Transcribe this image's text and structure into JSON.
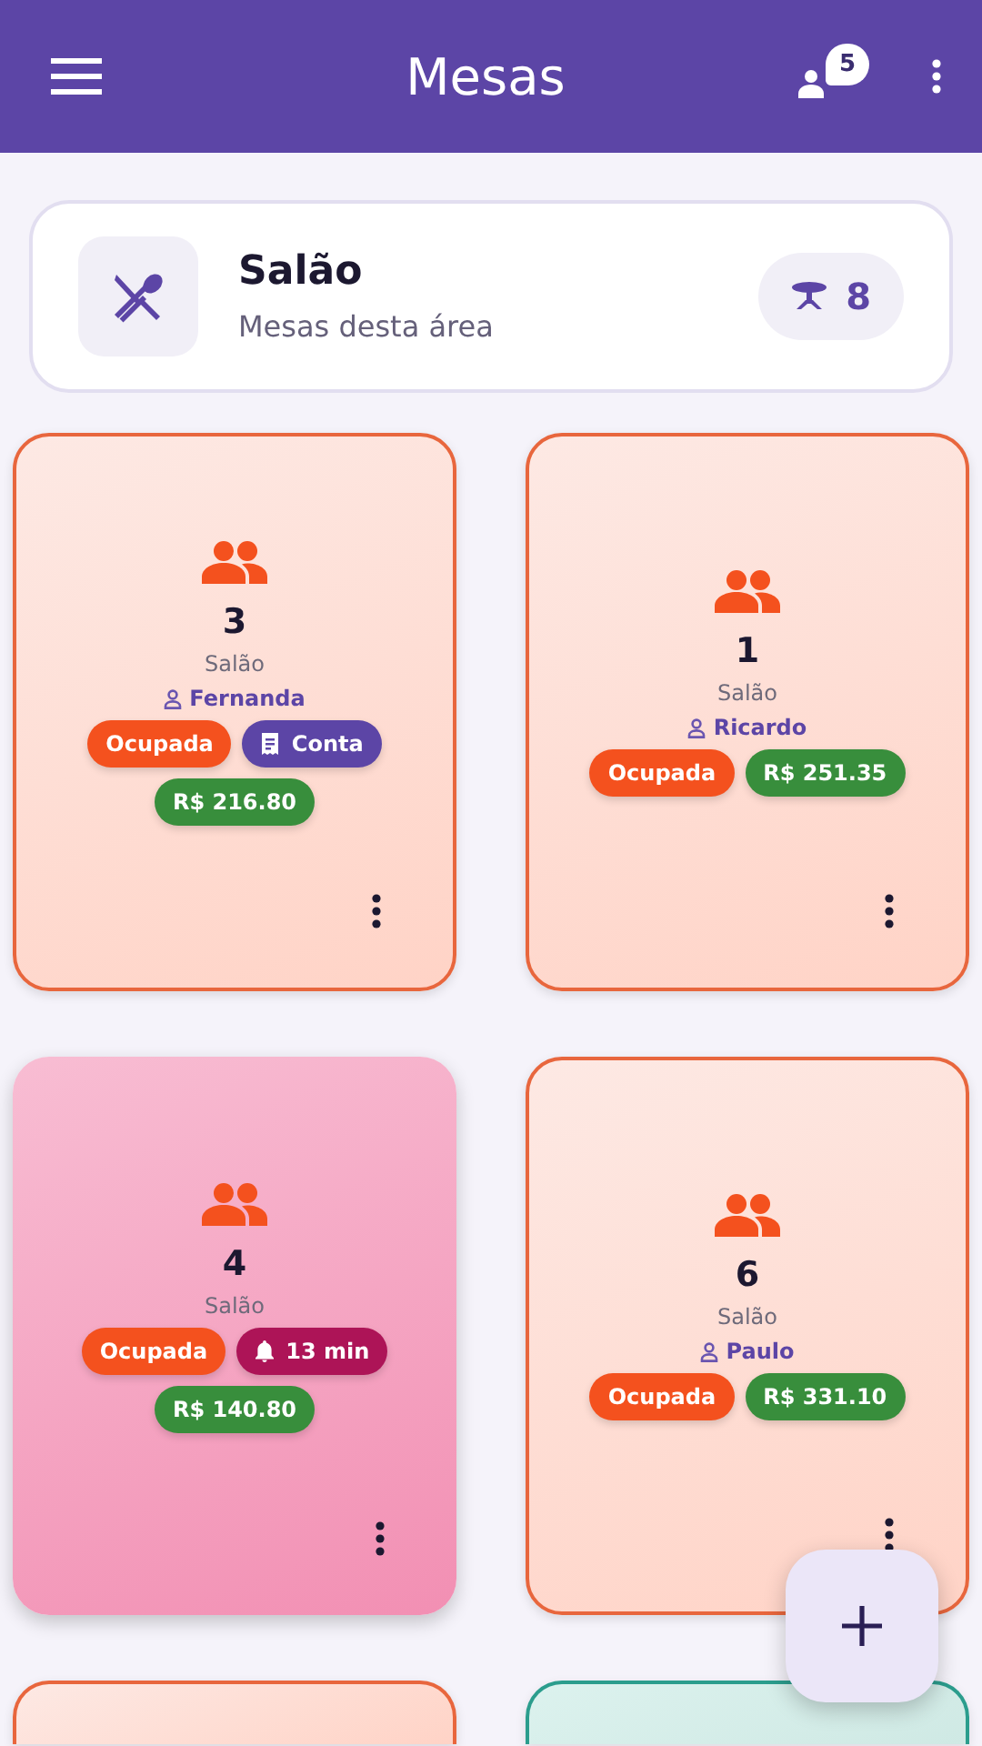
{
  "app_bar": {
    "title": "Mesas",
    "waiting_count": "5"
  },
  "area": {
    "name": "Salão",
    "subtitle": "Mesas desta área",
    "table_count": "8"
  },
  "tables": [
    {
      "kind": "occupied",
      "number": "3",
      "area": "Salão",
      "waiter": "Fernanda",
      "badges": [
        {
          "kind": "status",
          "label": "Ocupada"
        },
        {
          "kind": "bill",
          "label": "Conta"
        },
        {
          "kind": "total",
          "label": "R$ 216.80"
        }
      ]
    },
    {
      "kind": "occupied",
      "number": "1",
      "area": "Salão",
      "waiter": "Ricardo",
      "badges": [
        {
          "kind": "status",
          "label": "Ocupada"
        },
        {
          "kind": "total",
          "label": "R$ 251.35"
        }
      ]
    },
    {
      "kind": "alert",
      "number": "4",
      "area": "Salão",
      "badges": [
        {
          "kind": "status",
          "label": "Ocupada"
        },
        {
          "kind": "alert",
          "label": "13 min"
        },
        {
          "kind": "total",
          "label": "R$ 140.80"
        }
      ]
    },
    {
      "kind": "occupied",
      "number": "6",
      "area": "Salão",
      "waiter": "Paulo",
      "badges": [
        {
          "kind": "status",
          "label": "Ocupada"
        },
        {
          "kind": "total",
          "label": "R$ 331.10"
        }
      ]
    },
    {
      "kind": "occupied"
    },
    {
      "kind": "free"
    }
  ]
}
